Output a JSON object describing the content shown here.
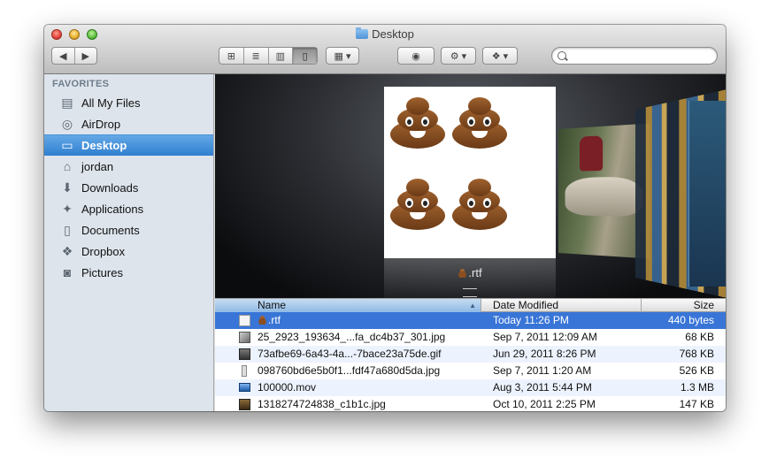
{
  "window": {
    "title": "Desktop"
  },
  "toolbar": {
    "nav_back_label": "◀",
    "nav_forward_label": "▶",
    "view_icons": "⊞",
    "view_list": "≣",
    "view_columns": "▥",
    "view_coverflow": "▯",
    "arrange_label": "▦ ▾",
    "quicklook_label": "◉",
    "action_label": "⚙ ▾",
    "dropbox_label": "❖ ▾",
    "search_placeholder": ""
  },
  "sidebar": {
    "header": "FAVORITES",
    "items": [
      {
        "label": "All My Files",
        "icon": "all-files-icon",
        "glyph": "▤"
      },
      {
        "label": "AirDrop",
        "icon": "airdrop-icon",
        "glyph": "◎"
      },
      {
        "label": "Desktop",
        "icon": "desktop-icon",
        "glyph": "▭",
        "selected": true
      },
      {
        "label": "jordan",
        "icon": "home-icon",
        "glyph": "⌂"
      },
      {
        "label": "Downloads",
        "icon": "downloads-icon",
        "glyph": "⬇"
      },
      {
        "label": "Applications",
        "icon": "applications-icon",
        "glyph": "✦"
      },
      {
        "label": "Documents",
        "icon": "documents-icon",
        "glyph": "▯"
      },
      {
        "label": "Dropbox",
        "icon": "dropbox-icon",
        "glyph": "❖"
      },
      {
        "label": "Pictures",
        "icon": "pictures-icon",
        "glyph": "◙"
      }
    ]
  },
  "coverflow": {
    "selected_label": ".rtf"
  },
  "list": {
    "columns": {
      "name": "Name",
      "date": "Date Modified",
      "size": "Size"
    },
    "rows": [
      {
        "name": ".rtf",
        "date": "Today 11:26 PM",
        "size": "440 bytes",
        "icon": "rtf-document-icon",
        "selected": true,
        "emoji": true
      },
      {
        "name": "25_2923_193634_...fa_dc4b37_301.jpg",
        "date": "Sep 7, 2011 12:09 AM",
        "size": "68 KB",
        "icon": "jpg-image-icon"
      },
      {
        "name": "73afbe69-6a43-4a...-7bace23a75de.gif",
        "date": "Jun 29, 2011 8:26 PM",
        "size": "768 KB",
        "icon": "gif-image-icon"
      },
      {
        "name": "098760bd6e5b0f1...fdf47a680d5da.jpg",
        "date": "Sep 7, 2011 1:20 AM",
        "size": "526 KB",
        "icon": "jpg-image-icon"
      },
      {
        "name": "100000.mov",
        "date": "Aug 3, 2011 5:44 PM",
        "size": "1.3 MB",
        "icon": "movie-file-icon"
      },
      {
        "name": "1318274724838_c1b1c.jpg",
        "date": "Oct 10, 2011 2:25 PM",
        "size": "147 KB",
        "icon": "jpg-image-icon"
      }
    ]
  },
  "colors": {
    "selection": "#3875d7",
    "sidebar_bg": "#dde4ec",
    "sidebar_selection": "#2f7fd0"
  }
}
